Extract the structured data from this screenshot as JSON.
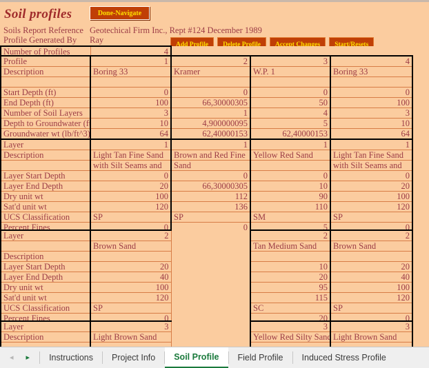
{
  "window": {
    "top_strip_color": "#c9b8aa"
  },
  "header": {
    "title": "Soil profiles",
    "done_button": "Done-Navigate",
    "report_reference_label": "Soils Report Reference",
    "report_reference_value": "Geotechical Firm Inc., Rept #124 December 1989",
    "generated_by_label": "Profile Generated By",
    "generated_by_value": "Ray",
    "buttons": [
      "Add Profile",
      "Delete Profile",
      "Accept Changes",
      "Start/Resets"
    ],
    "accent_button_bg": "#c03f06",
    "accent_button_fg": "#ffe000",
    "text_color": "#9c3c46"
  },
  "summary": {
    "number_of_profiles_label": "Number of Profiles",
    "number_of_profiles_value": "4"
  },
  "profile_block": {
    "rows": [
      {
        "label": "Profile",
        "align": "num",
        "values": [
          "1",
          "2",
          "3",
          "4"
        ]
      },
      {
        "label": "Description",
        "align": "txt",
        "values": [
          "Boring 33",
          "Kramer",
          "W.P. 1",
          "Boring 33"
        ]
      },
      {
        "label": "",
        "align": "txt",
        "values": [
          "",
          "",
          "",
          ""
        ]
      },
      {
        "label": "Start Depth (ft)",
        "align": "num",
        "values": [
          "0",
          "0",
          "0",
          "0"
        ]
      },
      {
        "label": "End Depth (ft)",
        "align": "num",
        "values": [
          "100",
          "66,30000305",
          "50",
          "100"
        ]
      },
      {
        "label": "Number of Soil Layers",
        "align": "num",
        "values": [
          "3",
          "1",
          "4",
          "3"
        ]
      },
      {
        "label": "Depth to Groundwater (ft)",
        "align": "num",
        "values": [
          "10",
          "4,900000095",
          "5",
          "10"
        ]
      },
      {
        "label": "Groundwater wt (lb/ft^3)",
        "align": "num",
        "values": [
          "64",
          "62,40000153",
          "62,40000153",
          "64"
        ]
      }
    ]
  },
  "layer1_block": {
    "rows": [
      {
        "label": "Layer",
        "align": "num",
        "values": [
          "1",
          "1",
          "1",
          "1"
        ]
      },
      {
        "label": "Description",
        "align": "txt",
        "values": [
          "Light Tan Fine Sand",
          "Brown and Red Fine",
          "Yellow Red Sand",
          "Light Tan Fine Sand"
        ]
      },
      {
        "label": "",
        "align": "txt",
        "values": [
          "with Silt Seams and",
          "Sand",
          "",
          "with Silt Seams and"
        ]
      },
      {
        "label": "Layer Start Depth",
        "align": "num",
        "values": [
          "0",
          "0",
          "0",
          "0"
        ]
      },
      {
        "label": "Layer End Depth",
        "align": "num",
        "values": [
          "20",
          "66,30000305",
          "10",
          "20"
        ]
      },
      {
        "label": "Dry unit wt",
        "align": "num",
        "values": [
          "100",
          "112",
          "90",
          "100"
        ]
      },
      {
        "label": "Sat'd unit wt",
        "align": "num",
        "values": [
          "120",
          "136",
          "110",
          "120"
        ]
      },
      {
        "label": "UCS Classification",
        "align": "txt",
        "values": [
          "SP",
          "SP",
          "SM",
          "SP"
        ]
      },
      {
        "label": "Percent Fines",
        "align": "num",
        "values": [
          "0",
          "0",
          "5",
          "0"
        ]
      }
    ]
  },
  "layer2_block": {
    "rows": [
      {
        "label": "Layer",
        "align": "num",
        "values": [
          "2",
          "",
          "2",
          "2"
        ]
      },
      {
        "label": "",
        "align": "txt",
        "values": [
          "Brown Sand",
          "",
          "Tan Medium Sand",
          "Brown Sand"
        ]
      },
      {
        "label": "Description",
        "align": "txt",
        "values": [
          "",
          "",
          "",
          ""
        ]
      },
      {
        "label": "Layer Start Depth",
        "align": "num",
        "values": [
          "20",
          "",
          "10",
          "20"
        ]
      },
      {
        "label": "Layer End Depth",
        "align": "num",
        "values": [
          "40",
          "",
          "20",
          "40"
        ]
      },
      {
        "label": "Dry unit wt",
        "align": "num",
        "values": [
          "100",
          "",
          "95",
          "100"
        ]
      },
      {
        "label": "Sat'd unit wt",
        "align": "num",
        "values": [
          "120",
          "",
          "115",
          "120"
        ]
      },
      {
        "label": "UCS Classification",
        "align": "txt",
        "values": [
          "SP",
          "",
          "SC",
          "SP"
        ]
      },
      {
        "label": "Percent Fines",
        "align": "num",
        "values": [
          "0",
          "",
          "20",
          "0"
        ]
      }
    ]
  },
  "layer3_block": {
    "rows": [
      {
        "label": "Layer",
        "align": "num",
        "values": [
          "3",
          "",
          "3",
          "3"
        ]
      },
      {
        "label": "Description",
        "align": "txt",
        "values": [
          "Light Brown Sand",
          "",
          "Yellow Red Silty Sand",
          "Light Brown Sand"
        ]
      },
      {
        "label": "",
        "align": "txt",
        "values": [
          "",
          "",
          "",
          ""
        ]
      }
    ]
  },
  "tabbar": {
    "prev_arrow": "◂",
    "next_arrow": "▸",
    "tabs": [
      {
        "label": "Instructions",
        "active": false
      },
      {
        "label": "Project Info",
        "active": false
      },
      {
        "label": "Soil Profile",
        "active": true
      },
      {
        "label": "Field Profile",
        "active": false
      },
      {
        "label": "Induced Stress Profile",
        "active": false
      }
    ],
    "active_color": "#1a7a3c"
  }
}
